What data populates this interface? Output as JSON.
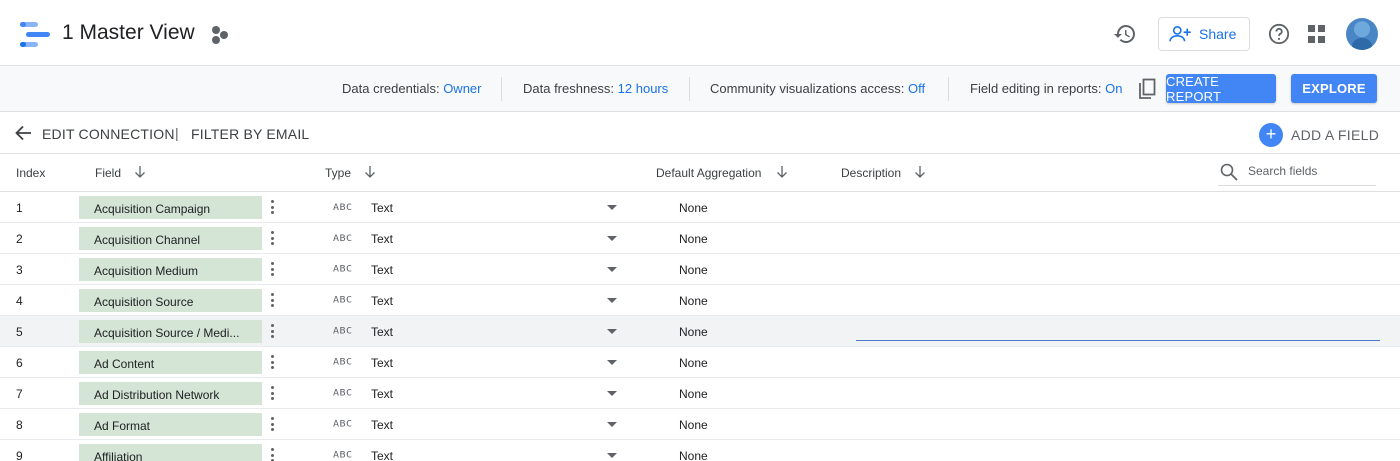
{
  "header": {
    "title": "1 Master View",
    "share_label": "Share",
    "logo_colors": [
      "#4285f4",
      "#1a73e8",
      "#8ab4f8"
    ]
  },
  "infobar": {
    "credentials_label": "Data credentials:",
    "credentials_value": "Owner",
    "freshness_label": "Data freshness:",
    "freshness_value": "12 hours",
    "community_label": "Community visualizations access:",
    "community_value": "Off",
    "field_editing_label": "Field editing in reports:",
    "field_editing_value": "On",
    "create_report_label": "CREATE REPORT",
    "explore_label": "EXPLORE"
  },
  "editbar": {
    "edit_connection_label": "EDIT CONNECTION",
    "separator": "|",
    "filter_label": "FILTER BY EMAIL",
    "add_field_label": "ADD A FIELD",
    "add_icon_glyph": "+"
  },
  "table": {
    "columns": {
      "index": "Index",
      "field": "Field",
      "type": "Type",
      "aggregation": "Default Aggregation",
      "description": "Description"
    },
    "search_placeholder": "Search fields",
    "type_icon_text": "ABC",
    "rows": [
      {
        "index": "1",
        "field": "Acquisition Campaign",
        "type": "Text",
        "aggregation": "None"
      },
      {
        "index": "2",
        "field": "Acquisition Channel",
        "type": "Text",
        "aggregation": "None"
      },
      {
        "index": "3",
        "field": "Acquisition Medium",
        "type": "Text",
        "aggregation": "None"
      },
      {
        "index": "4",
        "field": "Acquisition Source",
        "type": "Text",
        "aggregation": "None"
      },
      {
        "index": "5",
        "field": "Acquisition Source / Medi...",
        "type": "Text",
        "aggregation": "None",
        "highlighted": true
      },
      {
        "index": "6",
        "field": "Ad Content",
        "type": "Text",
        "aggregation": "None"
      },
      {
        "index": "7",
        "field": "Ad Distribution Network",
        "type": "Text",
        "aggregation": "None"
      },
      {
        "index": "8",
        "field": "Ad Format",
        "type": "Text",
        "aggregation": "None"
      },
      {
        "index": "9",
        "field": "Affiliation",
        "type": "Text",
        "aggregation": "None"
      }
    ]
  },
  "colors": {
    "accent": "#1a73e8",
    "button": "#4285f4",
    "chip": "#d4e5d6"
  }
}
